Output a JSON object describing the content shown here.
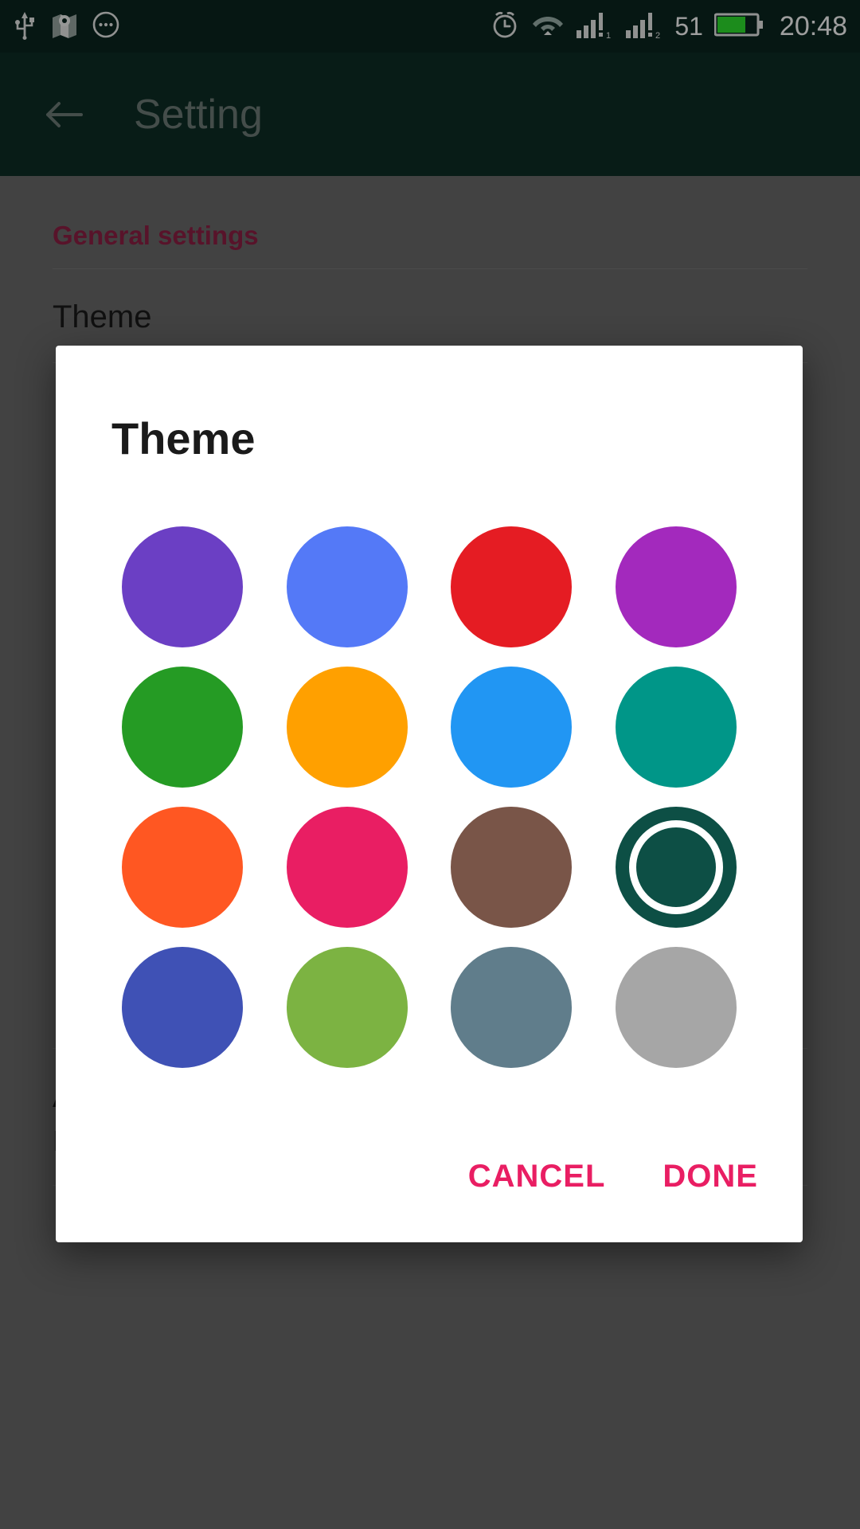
{
  "status_bar": {
    "background": "#0a2620",
    "left_icons": [
      {
        "name": "usb-icon",
        "label": "USB"
      },
      {
        "name": "location-map-icon",
        "label": "Map"
      },
      {
        "name": "more-dots-icon",
        "label": "More notifications"
      }
    ],
    "right_icons": [
      {
        "name": "alarm-clock-icon",
        "label": "Alarm"
      },
      {
        "name": "wifi-icon",
        "label": "Wi-Fi"
      },
      {
        "name": "signal-sim1-icon",
        "label": "Signal SIM 1"
      },
      {
        "name": "signal-sim2-icon",
        "label": "Signal SIM 2"
      }
    ],
    "battery_percent": "51",
    "battery_icon": "battery-icon",
    "battery_color": "#22dd22",
    "clock": "20:48"
  },
  "app_bar": {
    "back_icon": "back-arrow-icon",
    "title": "Setting",
    "background": "#0d2e26",
    "title_color": "#6e7c78"
  },
  "settings_page": {
    "section_title": "General settings",
    "section_title_color": "#8e1f44",
    "rows": [
      {
        "title": "Theme",
        "subtitle": "",
        "has_checkbox": false
      },
      {
        "title": "Advanced password protection",
        "subtitle": "Password will remove when clean the app data",
        "has_checkbox": true
      }
    ]
  },
  "dialog": {
    "title": "Theme",
    "accent": "#e91e63",
    "background": "#ffffff",
    "selected_index": 11,
    "swatches": [
      {
        "index": 0,
        "name": "swatch-deep-purple",
        "color": "#6b3fc4",
        "selected": false
      },
      {
        "index": 1,
        "name": "swatch-cornflower-blue",
        "color": "#5479f7",
        "selected": false
      },
      {
        "index": 2,
        "name": "swatch-red",
        "color": "#e51c23",
        "selected": false
      },
      {
        "index": 3,
        "name": "swatch-magenta-purple",
        "color": "#a329bd",
        "selected": false
      },
      {
        "index": 4,
        "name": "swatch-green",
        "color": "#259b24",
        "selected": false
      },
      {
        "index": 5,
        "name": "swatch-orange",
        "color": "#ffa000",
        "selected": false
      },
      {
        "index": 6,
        "name": "swatch-light-blue",
        "color": "#2196f3",
        "selected": false
      },
      {
        "index": 7,
        "name": "swatch-teal",
        "color": "#009688",
        "selected": false
      },
      {
        "index": 8,
        "name": "swatch-deep-orange",
        "color": "#ff5722",
        "selected": false
      },
      {
        "index": 9,
        "name": "swatch-pink",
        "color": "#e91e63",
        "selected": false
      },
      {
        "index": 10,
        "name": "swatch-brown",
        "color": "#795548",
        "selected": false
      },
      {
        "index": 11,
        "name": "swatch-dark-teal",
        "color": "#0d4f45",
        "selected": true
      },
      {
        "index": 12,
        "name": "swatch-indigo",
        "color": "#3f51b5",
        "selected": false
      },
      {
        "index": 13,
        "name": "swatch-light-green",
        "color": "#7cb342",
        "selected": false
      },
      {
        "index": 14,
        "name": "swatch-blue-grey",
        "color": "#607d8b",
        "selected": false
      },
      {
        "index": 15,
        "name": "swatch-grey",
        "color": "#a6a6a6",
        "selected": false
      }
    ],
    "cancel_label": "CANCEL",
    "done_label": "DONE"
  }
}
